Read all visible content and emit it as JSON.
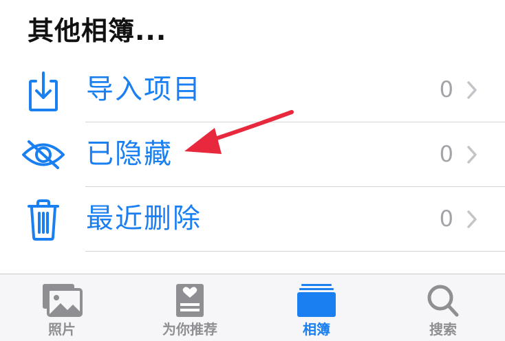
{
  "section": {
    "title": "其他相簿..."
  },
  "rows": [
    {
      "label": "导入项目",
      "count": "0",
      "icon": "import-icon"
    },
    {
      "label": "已隐藏",
      "count": "0",
      "icon": "eye-slash-icon"
    },
    {
      "label": "最近删除",
      "count": "0",
      "icon": "trash-icon"
    }
  ],
  "tabs": [
    {
      "label": "照片",
      "icon": "photos-icon",
      "active": false
    },
    {
      "label": "为你推荐",
      "icon": "for-you-icon",
      "active": false
    },
    {
      "label": "相簿",
      "icon": "albums-icon",
      "active": true
    },
    {
      "label": "搜索",
      "icon": "search-icon",
      "active": false
    }
  ],
  "colors": {
    "accent": "#1a7ff0",
    "muted": "#8e8e93",
    "annotation_arrow": "#e8283c"
  }
}
